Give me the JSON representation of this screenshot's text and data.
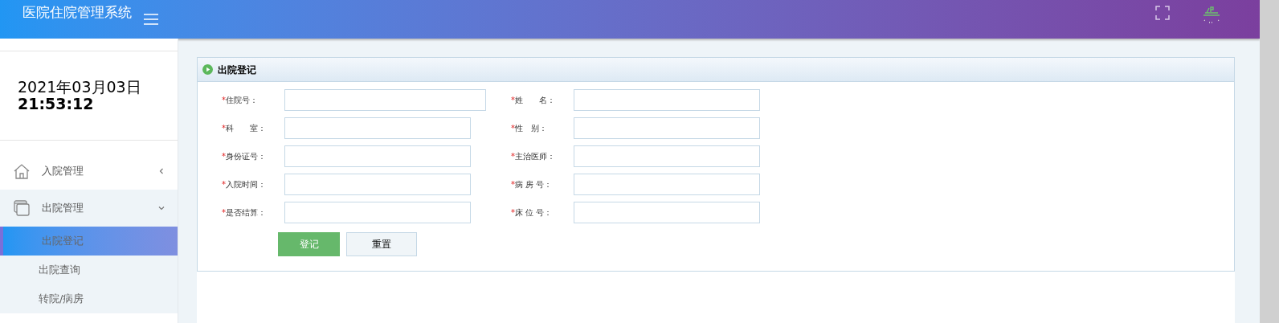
{
  "header": {
    "title": "医院住院管理系统"
  },
  "sidebar": {
    "date": "2021年03月03日",
    "time": "21:53:12",
    "menu": [
      {
        "label": "入院管理",
        "expanded": false
      },
      {
        "label": "出院管理",
        "expanded": true,
        "children": [
          {
            "label": "出院登记",
            "selected": true
          },
          {
            "label": "出院查询",
            "selected": false
          },
          {
            "label": "转院/病房",
            "selected": false
          }
        ]
      }
    ]
  },
  "panel": {
    "title": "出院登记",
    "fields": [
      {
        "label": "住院号：",
        "required_mark": "*",
        "wide": true
      },
      {
        "label": "姓　　名：",
        "required_mark": "*",
        "wide": false
      },
      {
        "label": "科　　室：",
        "required_mark": "*",
        "wide": false
      },
      {
        "label": "性　别：",
        "required_mark": "*",
        "wide": false
      },
      {
        "label": "身份证号：",
        "required_mark": "*",
        "wide": false
      },
      {
        "label": "主治医师：",
        "required_mark": "*",
        "wide": false
      },
      {
        "label": "入院时间：",
        "required_mark": "*",
        "wide": false
      },
      {
        "label": "病 房 号：",
        "required_mark": "*",
        "wide": false
      },
      {
        "label": "是否结算：",
        "required_mark": "*",
        "wide": false
      },
      {
        "label": "床 位 号：",
        "required_mark": "*",
        "wide": false
      }
    ],
    "buttons": [
      {
        "label": "登记",
        "kind": "primary"
      },
      {
        "label": "重置",
        "kind": "secondary"
      }
    ]
  }
}
